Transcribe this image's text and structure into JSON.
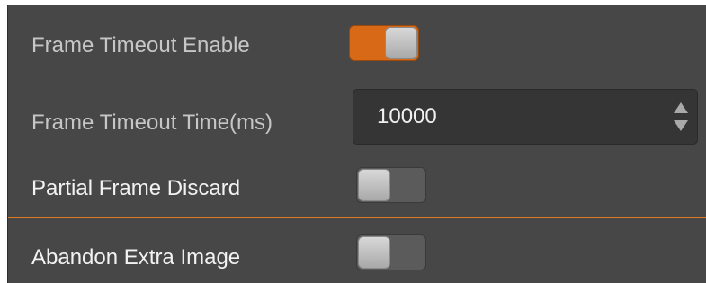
{
  "settings": {
    "frame_timeout_enable": {
      "label": "Frame Timeout Enable",
      "state": "on"
    },
    "frame_timeout_time": {
      "label": "Frame Timeout Time(ms)",
      "value": "10000"
    },
    "partial_frame_discard": {
      "label": "Partial Frame Discard",
      "state": "off"
    },
    "abandon_extra_image": {
      "label": "Abandon Extra Image",
      "state": "off"
    }
  },
  "colors": {
    "panel_background": "#474747",
    "toggle_on": "#d86a17",
    "toggle_off": "#5b5b5b",
    "divider_accent": "#e07a22",
    "input_background": "#353535"
  },
  "icons": {
    "spin_up": "triangle-up-icon",
    "spin_down": "triangle-down-icon"
  }
}
